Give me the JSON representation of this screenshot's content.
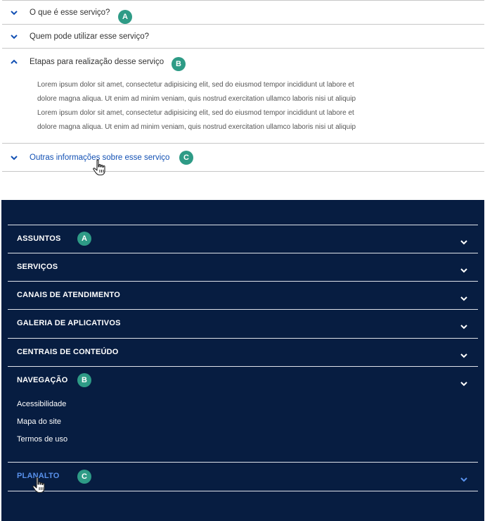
{
  "accordion": {
    "items": [
      {
        "title": "O que é esse serviço?",
        "badge": "A"
      },
      {
        "title": "Quem pode utilizar esse serviço?"
      },
      {
        "title": "Etapas para realização desse serviço",
        "badge": "B",
        "body": [
          "Lorem ipsum dolor sit amet, consectetur adipisicing elit, sed do eiusmod tempor incididunt ut labore et",
          "dolore magna aliqua. Ut enim ad minim veniam, quis nostrud exercitation ullamco laboris nisi ut aliquip",
          "Lorem ipsum dolor sit amet, consectetur adipisicing elit, sed do eiusmod tempor incididunt ut labore et",
          "dolore magna aliqua. Ut enim ad minim veniam, quis nostrud exercitation ullamco laboris nisi ut aliquip"
        ]
      },
      {
        "title": "Outras informações sobre esse serviço",
        "badge": "C"
      }
    ]
  },
  "footer": {
    "items": [
      {
        "label": "ASSUNTOS",
        "badge": "A"
      },
      {
        "label": "SERVIÇOS"
      },
      {
        "label": "CANAIS DE ATENDIMENTO"
      },
      {
        "label": "GALERIA DE APLICATIVOS"
      },
      {
        "label": "CENTRAIS DE CONTEÚDO"
      },
      {
        "label": "NAVEGAÇÃO",
        "badge": "B",
        "sub": [
          "Acessibilidade",
          "Mapa do site",
          "Termos de uso"
        ]
      },
      {
        "label": "PLANALTO",
        "badge": "C"
      }
    ]
  },
  "colors": {
    "primary_blue": "#1351b4",
    "footer_bg": "#071d41",
    "footer_link": "#5992ed",
    "badge": "#2e9b86"
  }
}
